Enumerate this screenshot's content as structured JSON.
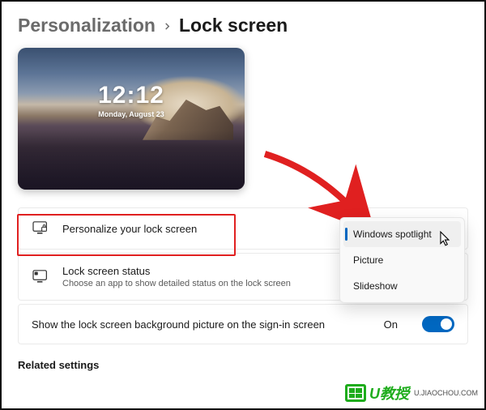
{
  "breadcrumb": {
    "parent": "Personalization",
    "current": "Lock screen"
  },
  "preview": {
    "time": "12:12",
    "date": "Monday, August 23"
  },
  "rows": {
    "personalize": {
      "title": "Personalize your lock screen"
    },
    "status": {
      "title": "Lock screen status",
      "sub": "Choose an app to show detailed status on the lock screen"
    },
    "signin_bg": {
      "title": "Show the lock screen background picture on the sign-in screen",
      "value_label": "On",
      "value": true
    }
  },
  "dropdown": {
    "items": [
      {
        "label": "Windows spotlight",
        "selected": true,
        "hover": true
      },
      {
        "label": "Picture",
        "selected": false,
        "hover": false
      },
      {
        "label": "Slideshow",
        "selected": false,
        "hover": false
      }
    ]
  },
  "section": {
    "related": "Related settings"
  },
  "annotation": {
    "arrow_color": "#e02020",
    "highlight_color": "#e02020"
  },
  "watermark": {
    "brand": "U教授",
    "url": "U.JIAOCHOU.COM"
  }
}
